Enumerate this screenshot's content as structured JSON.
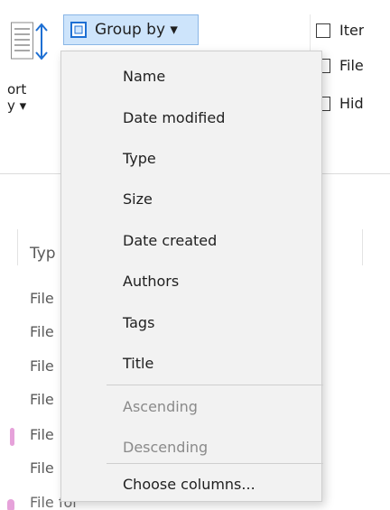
{
  "ribbon": {
    "sort": {
      "label_top": "ort",
      "label_bottom": "y ▾",
      "icon": "sort-icon"
    },
    "group_by": {
      "label": "Group by ▾",
      "icon": "group-by-icon",
      "accent": "#1d6fd3"
    },
    "right_options": [
      {
        "label": "Iter",
        "checked": false
      },
      {
        "label": "File",
        "checked": false
      },
      {
        "label": "Hid",
        "checked": false
      }
    ]
  },
  "list": {
    "column_header": "Typ",
    "rows": [
      "File",
      "File",
      "File",
      "File",
      "File",
      "File",
      "File fol"
    ]
  },
  "menu": {
    "items": [
      {
        "label": "Name",
        "enabled": true
      },
      {
        "label": "Date modified",
        "enabled": true
      },
      {
        "label": "Type",
        "enabled": true
      },
      {
        "label": "Size",
        "enabled": true
      },
      {
        "label": "Date created",
        "enabled": true
      },
      {
        "label": "Authors",
        "enabled": true
      },
      {
        "label": "Tags",
        "enabled": true
      },
      {
        "label": "Title",
        "enabled": true
      },
      {
        "label": "Ascending",
        "enabled": false
      },
      {
        "label": "Descending",
        "enabled": false
      },
      {
        "label": "Choose columns...",
        "enabled": true
      }
    ]
  },
  "colors": {
    "group_by_bg": "#cde4fb",
    "group_by_border": "#8ab6e6",
    "menu_bg": "#f2f2f2",
    "disabled_text": "#8a8a8a",
    "pink_marker": "#e6a2da"
  }
}
